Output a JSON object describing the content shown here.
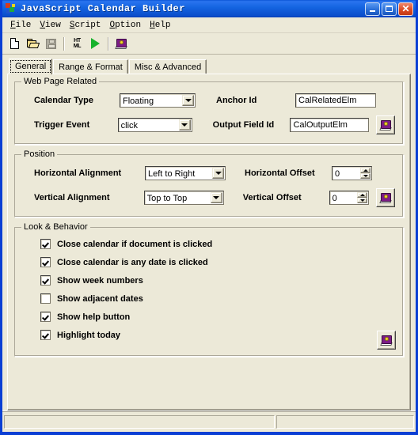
{
  "window": {
    "title": "JavaScript Calendar Builder",
    "app_icon": "app-logo-icon",
    "caption_buttons": [
      {
        "name": "minimize",
        "glyph": "minimize-icon"
      },
      {
        "name": "maximize",
        "glyph": "maximize-icon"
      },
      {
        "name": "close",
        "glyph": "close-icon",
        "label": "✕"
      }
    ]
  },
  "menu": {
    "items": [
      {
        "accel": "F",
        "rest": "ile"
      },
      {
        "accel": "V",
        "rest": "iew"
      },
      {
        "accel": "S",
        "rest": "cript"
      },
      {
        "accel": "O",
        "rest": "ption"
      },
      {
        "accel": "H",
        "rest": "elp"
      }
    ]
  },
  "toolbar": {
    "buttons": [
      {
        "name": "new-file-button",
        "icon": "new-document-icon"
      },
      {
        "name": "open-file-button",
        "icon": "open-folder-icon"
      },
      {
        "name": "save-file-button",
        "icon": "save-disk-icon",
        "disabled": true
      },
      {
        "name": "generate-html-button",
        "icon": "html-icon",
        "label_top": "HT",
        "label_bottom": "ML"
      },
      {
        "name": "run-button",
        "icon": "play-triangle-icon"
      },
      {
        "name": "help-button",
        "icon": "help-book-icon"
      }
    ]
  },
  "tabs": [
    {
      "label": "General",
      "active": true
    },
    {
      "label": "Range & Format",
      "active": false
    },
    {
      "label": "Misc & Advanced",
      "active": false
    }
  ],
  "groups": {
    "web_page_related": {
      "legend": "Web Page Related",
      "calendar_type_label": "Calendar Type",
      "calendar_type_value": "Floating",
      "trigger_event_label": "Trigger Event",
      "trigger_event_value": "click",
      "anchor_id_label": "Anchor Id",
      "anchor_id_value": "CalRelatedElm",
      "output_field_id_label": "Output Field Id",
      "output_field_id_value": "CalOutputElm",
      "help_icon": "help-book-icon"
    },
    "position": {
      "legend": "Position",
      "horizontal_alignment_label": "Horizontal Alignment",
      "horizontal_alignment_value": "Left to Right",
      "vertical_alignment_label": "Vertical Alignment",
      "vertical_alignment_value": "Top to Top",
      "horizontal_offset_label": "Horizontal Offset",
      "horizontal_offset_value": "0",
      "vertical_offset_label": "Vertical Offset",
      "vertical_offset_value": "0",
      "help_icon": "help-book-icon"
    },
    "look_behavior": {
      "legend": "Look & Behavior",
      "help_icon": "help-book-icon",
      "checkboxes": [
        {
          "label": "Close calendar if document is clicked",
          "checked": true
        },
        {
          "label": "Close calendar is any date is clicked",
          "checked": true
        },
        {
          "label": "Show week numbers",
          "checked": true
        },
        {
          "label": "Show adjacent dates",
          "checked": false
        },
        {
          "label": "Show help button",
          "checked": true
        },
        {
          "label": "Highlight today",
          "checked": true
        }
      ]
    }
  },
  "statusbar": {
    "pane1": "",
    "pane2": ""
  },
  "colors": {
    "title_bar_blue": "#0a54d6",
    "window_frame_blue": "#0a3fd4",
    "face": "#ece9d8",
    "close_button_red": "#dd4a22",
    "run_green": "#17b22c",
    "book_purple": "#7c1c86"
  }
}
